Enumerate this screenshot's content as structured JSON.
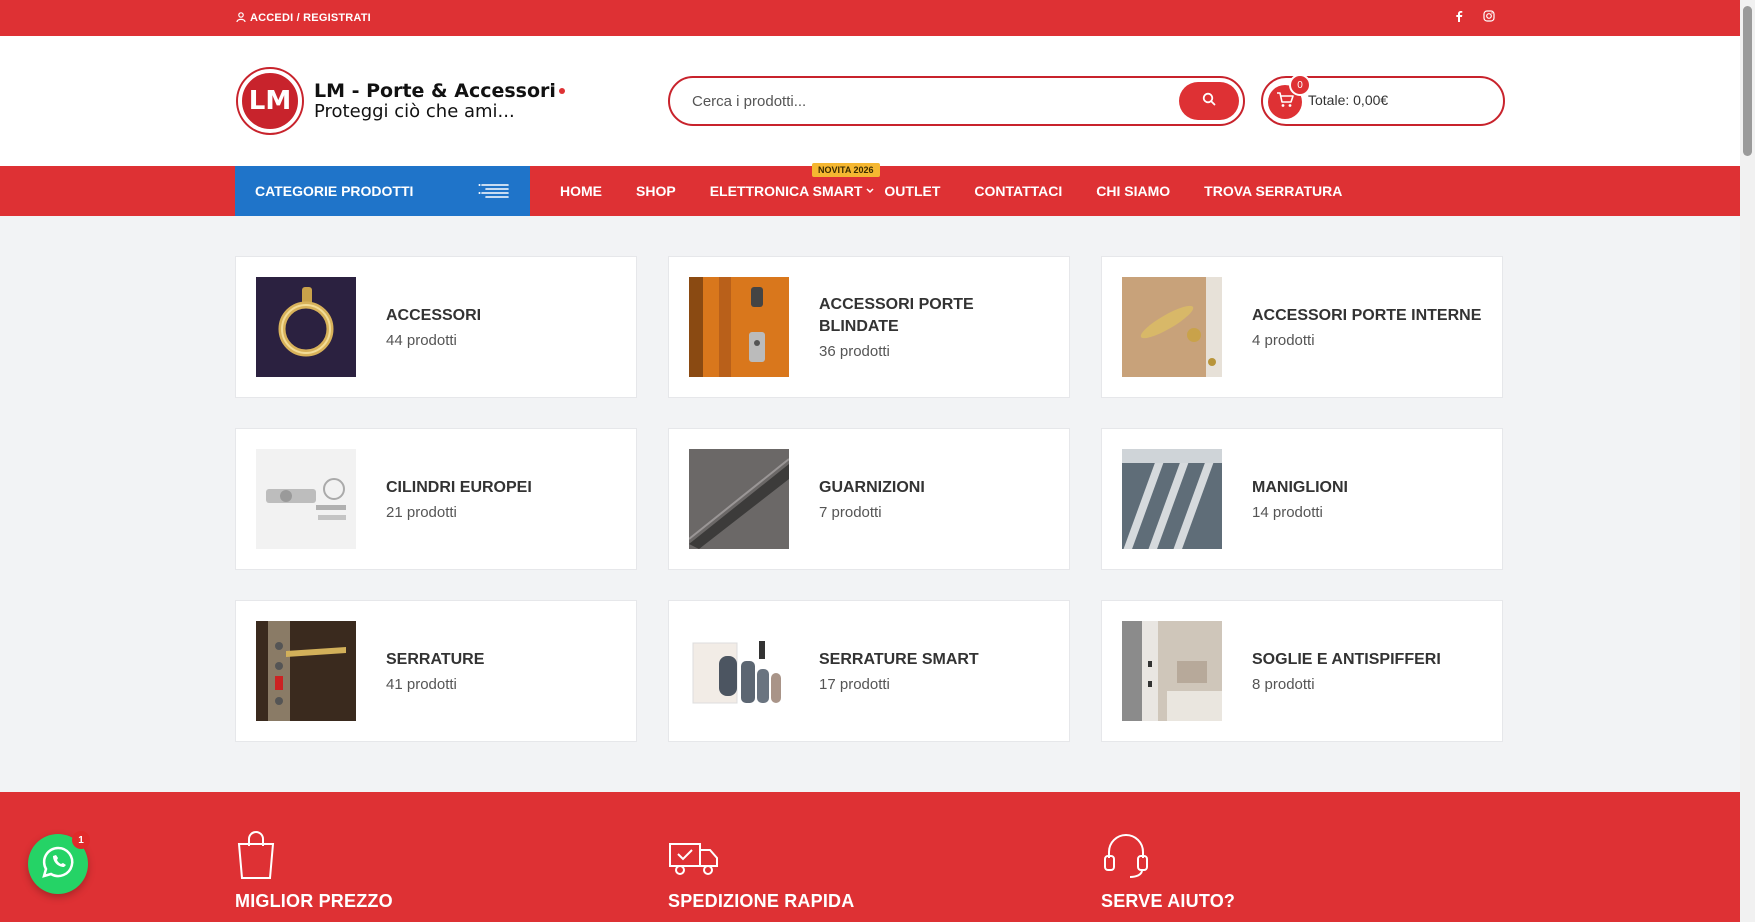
{
  "topbar": {
    "login_label": "ACCEDI / REGISTRATI"
  },
  "brand": {
    "name": "LM - Porte & Accessori",
    "tagline": "Proteggi ciò che ami...",
    "mark": "LM"
  },
  "search": {
    "placeholder": "Cerca i prodotti..."
  },
  "cart": {
    "count": "0",
    "total": "Totale: 0,00€"
  },
  "nav": {
    "categories_label": "CATEGORIE PRODOTTI",
    "items": [
      "HOME",
      "SHOP",
      "ELETTRONICA SMART",
      "OUTLET",
      "CONTATTACI",
      "CHI SIAMO",
      "TROVA SERRATURA"
    ],
    "new_tag": "NOVITA 2026"
  },
  "categories": [
    {
      "name": "ACCESSORI",
      "count": "44 prodotti"
    },
    {
      "name": "ACCESSORI PORTE BLINDATE",
      "count": "36 prodotti"
    },
    {
      "name": "ACCESSORI PORTE INTERNE",
      "count": "4 prodotti"
    },
    {
      "name": "CILINDRI EUROPEI",
      "count": "21 prodotti"
    },
    {
      "name": "GUARNIZIONI",
      "count": "7 prodotti"
    },
    {
      "name": "MANIGLIONI",
      "count": "14 prodotti"
    },
    {
      "name": "SERRATURE",
      "count": "41 prodotti"
    },
    {
      "name": "SERRATURE SMART",
      "count": "17 prodotti"
    },
    {
      "name": "SOGLIE E ANTISPIFFERI",
      "count": "8 prodotti"
    }
  ],
  "features": [
    {
      "title": "MIGLIOR PREZZO",
      "text": ""
    },
    {
      "title": "SPEDIZIONE RAPIDA",
      "text": ""
    },
    {
      "title": "SERVE AIUTO?",
      "text": ""
    }
  ],
  "whatsapp": {
    "badge": "1"
  },
  "colors": {
    "brand_red": "#de3134",
    "category_blue": "#1f74c9",
    "whatsapp_green": "#25d366",
    "new_tag": "#f5b731"
  }
}
